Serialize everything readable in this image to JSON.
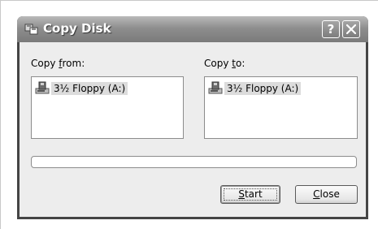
{
  "window": {
    "title": "Copy Disk",
    "title_icon": "copy-disk-icon",
    "help_button_label": "?",
    "close_button_icon": "close-x-icon"
  },
  "copy_from": {
    "label_prefix": "Copy ",
    "label_accel": "f",
    "label_suffix": "rom:",
    "items": [
      {
        "icon": "floppy-drive-icon",
        "label": "3½ Floppy (A:)"
      }
    ]
  },
  "copy_to": {
    "label_prefix": "Copy ",
    "label_accel": "t",
    "label_suffix": "o:",
    "items": [
      {
        "icon": "floppy-drive-icon",
        "label": "3½ Floppy (A:)"
      }
    ]
  },
  "progress": {
    "value": 0
  },
  "buttons": {
    "start_accel": "S",
    "start_rest": "tart",
    "close_accel": "C",
    "close_rest": "lose"
  },
  "colors": {
    "title_bar": "#8e8e8e",
    "client_bg": "#ededed",
    "selection": "#dcdcdc"
  }
}
